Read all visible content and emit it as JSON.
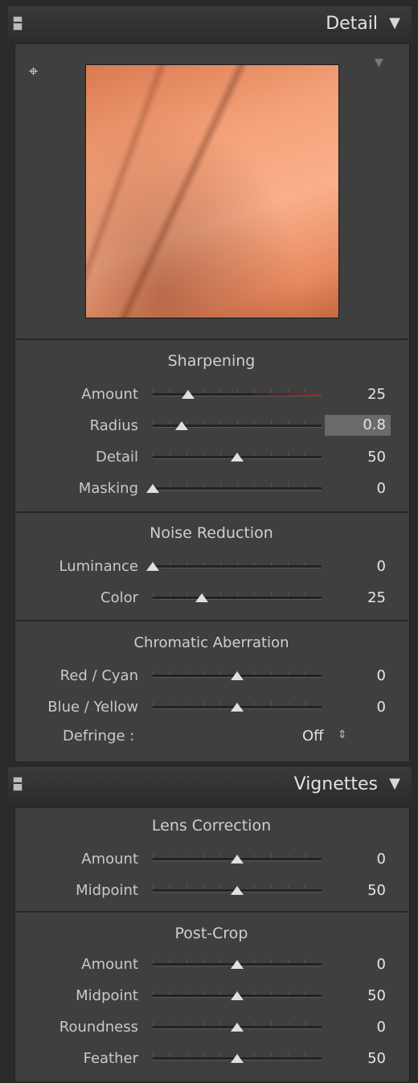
{
  "detail_header": {
    "title": "Detail",
    "collapse_icon": "triangle-down-icon"
  },
  "preview": {
    "menu_icon": "triangle-down-icon",
    "target_icon": "crosshair-icon"
  },
  "sharpening": {
    "title": "Sharpening",
    "rows": [
      {
        "label": "Amount",
        "value": "25",
        "pos": 0.21
      },
      {
        "label": "Radius",
        "value": "0.8",
        "pos": 0.17
      },
      {
        "label": "Detail",
        "value": "50",
        "pos": 0.5
      },
      {
        "label": "Masking",
        "value": "0",
        "pos": 0.0
      }
    ]
  },
  "noise": {
    "title": "Noise Reduction",
    "rows": [
      {
        "label": "Luminance",
        "value": "0",
        "pos": 0.0
      },
      {
        "label": "Color",
        "value": "25",
        "pos": 0.29
      }
    ]
  },
  "chromatic": {
    "title": "Chromatic Aberration",
    "rows": [
      {
        "label": "Red / Cyan",
        "value": "0",
        "pos": 0.5
      },
      {
        "label": "Blue / Yellow",
        "value": "0",
        "pos": 0.5
      }
    ],
    "defringe_label": "Defringe :",
    "defringe_value": "Off",
    "defringe_arrows": "⇕"
  },
  "vignettes_header": {
    "title": "Vignettes",
    "collapse_icon": "triangle-down-icon"
  },
  "lens_correction": {
    "title": "Lens Correction",
    "rows": [
      {
        "label": "Amount",
        "value": "0",
        "pos": 0.5
      },
      {
        "label": "Midpoint",
        "value": "50",
        "pos": 0.5
      }
    ]
  },
  "post_crop": {
    "title": "Post-Crop",
    "rows": [
      {
        "label": "Amount",
        "value": "0",
        "pos": 0.5
      },
      {
        "label": "Midpoint",
        "value": "50",
        "pos": 0.5
      },
      {
        "label": "Roundness",
        "value": "0",
        "pos": 0.5
      },
      {
        "label": "Feather",
        "value": "50",
        "pos": 0.5
      }
    ]
  },
  "colors": {
    "panel": "#3f3f3f",
    "header": "#333333",
    "amount_track_accent": "#8a2a2a"
  }
}
